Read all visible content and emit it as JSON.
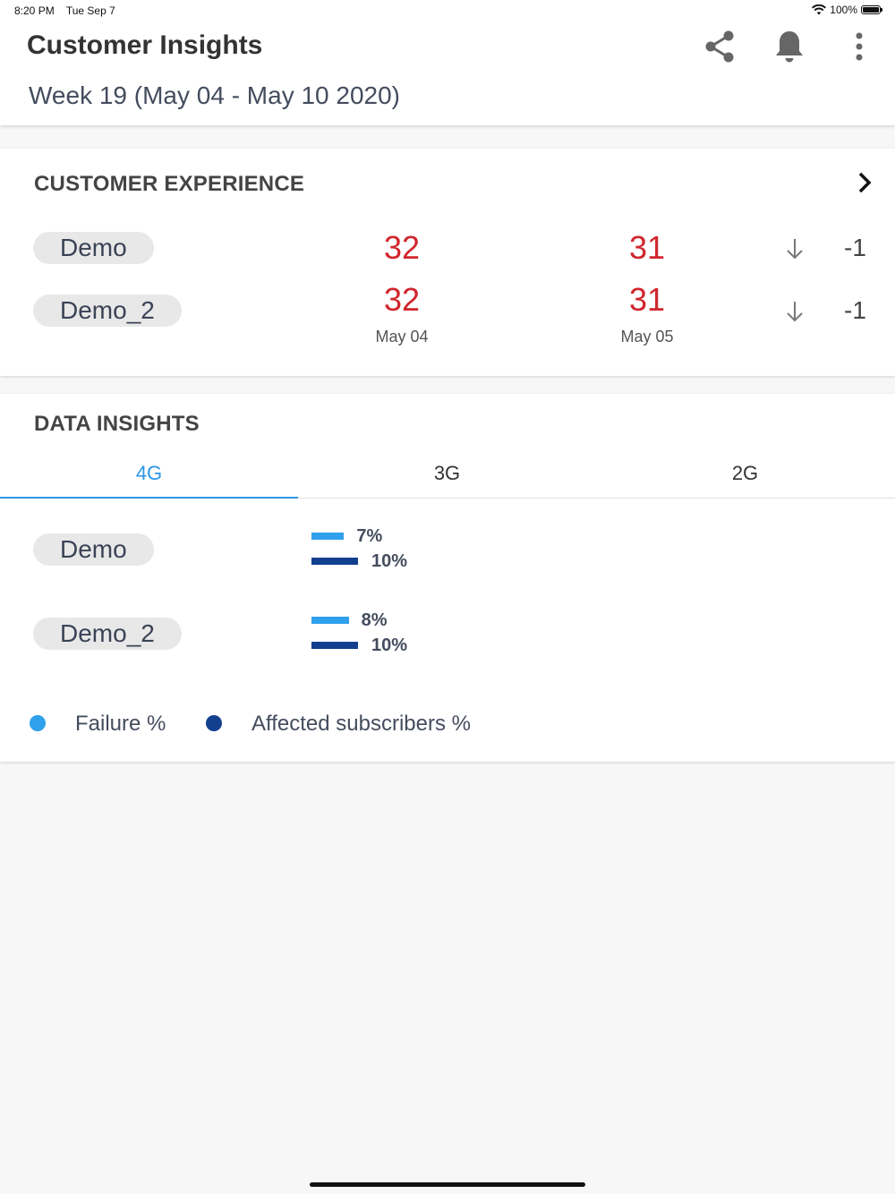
{
  "status_bar": {
    "time": "8:20 PM",
    "date": "Tue Sep 7",
    "battery": "100%"
  },
  "app_bar": {
    "title": "Customer Insights",
    "share_icon": "share-icon",
    "bell_icon": "bell-icon",
    "more_icon": "more-vertical-icon"
  },
  "week_label": "Week 19 (May 04 - May 10 2020)",
  "customer_experience": {
    "title": "CUSTOMER EXPERIENCE",
    "chevron_icon": "chevron-right-icon",
    "dates": [
      "May 04",
      "May 05"
    ],
    "rows": [
      {
        "name": "Demo",
        "value_1": "32",
        "value_2": "31",
        "trend": "down",
        "delta": "-1"
      },
      {
        "name": "Demo_2",
        "value_1": "32",
        "value_2": "31",
        "trend": "down",
        "delta": "-1"
      }
    ],
    "value_color": "#d0262d"
  },
  "data_insights": {
    "title": "DATA INSIGHTS",
    "tabs": [
      {
        "label": "4G",
        "active": true
      },
      {
        "label": "3G",
        "active": false
      },
      {
        "label": "2G",
        "active": false
      }
    ],
    "rows": [
      {
        "name": "Demo",
        "failure_pct": 7,
        "failure_label": "7%",
        "affected_pct": 10,
        "affected_label": "10%"
      },
      {
        "name": "Demo_2",
        "failure_pct": 8,
        "failure_label": "8%",
        "affected_pct": 10,
        "affected_label": "10%"
      }
    ],
    "legend": [
      {
        "label": "Failure %",
        "color": "#2fa0ec"
      },
      {
        "label": "Affected subscribers %",
        "color": "#133f8f"
      }
    ]
  }
}
